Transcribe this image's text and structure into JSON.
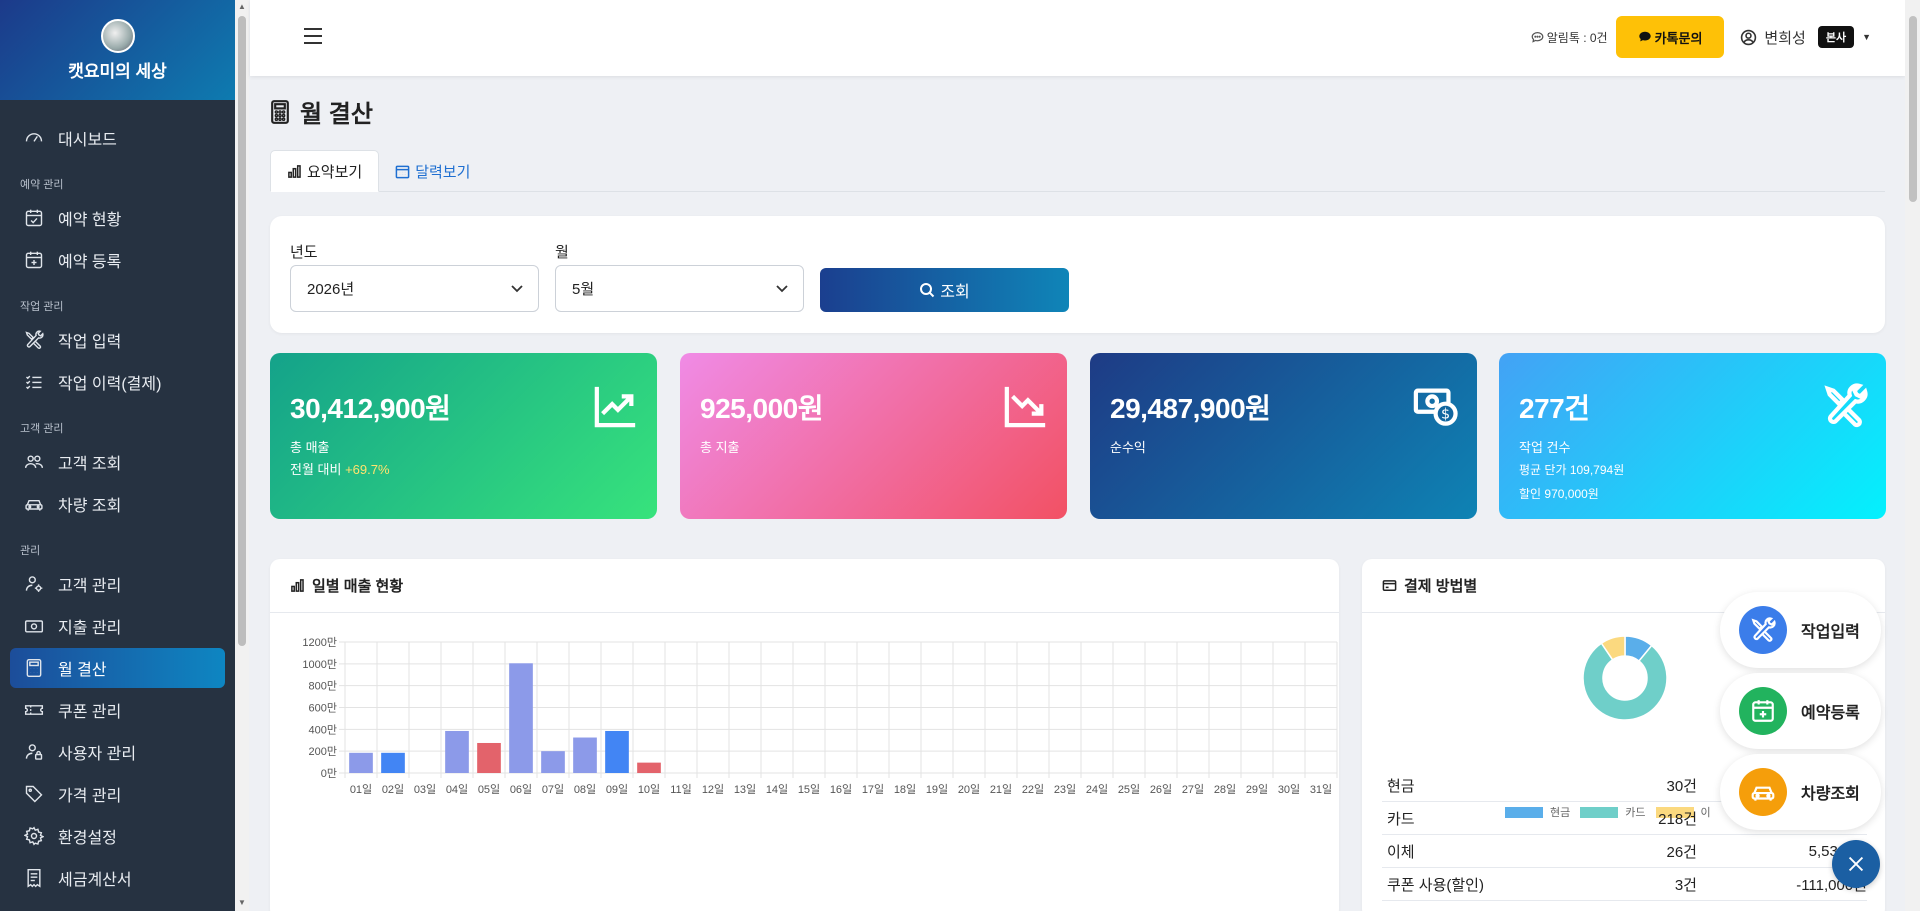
{
  "brand": {
    "name": "캣요미의 세상"
  },
  "sidebar": {
    "items": [
      {
        "type": "item",
        "label": "대시보드",
        "icon": "gauge-icon",
        "active": false
      },
      {
        "type": "section",
        "label": "예약 관리"
      },
      {
        "type": "item",
        "label": "예약 현황",
        "icon": "calendar-check-icon",
        "active": false
      },
      {
        "type": "item",
        "label": "예약 등록",
        "icon": "calendar-plus-icon",
        "active": false
      },
      {
        "type": "section",
        "label": "작업 관리"
      },
      {
        "type": "item",
        "label": "작업 입력",
        "icon": "tools-icon",
        "active": false
      },
      {
        "type": "item",
        "label": "작업 이력(결제)",
        "icon": "list-check-icon",
        "active": false
      },
      {
        "type": "section",
        "label": "고객 관리"
      },
      {
        "type": "item",
        "label": "고객 조회",
        "icon": "people-icon",
        "active": false
      },
      {
        "type": "item",
        "label": "차량 조회",
        "icon": "car-icon",
        "active": false
      },
      {
        "type": "section",
        "label": "관리"
      },
      {
        "type": "item",
        "label": "고객 관리",
        "icon": "person-gear-icon",
        "active": false
      },
      {
        "type": "item",
        "label": "지출 관리",
        "icon": "cash-icon",
        "active": false
      },
      {
        "type": "item",
        "label": "월 결산",
        "icon": "calculator-icon",
        "active": true
      },
      {
        "type": "item",
        "label": "쿠폰 관리",
        "icon": "ticket-icon",
        "active": false
      },
      {
        "type": "item",
        "label": "사용자 관리",
        "icon": "person-lock-icon",
        "active": false
      },
      {
        "type": "item",
        "label": "가격 관리",
        "icon": "tag-icon",
        "active": false
      },
      {
        "type": "item",
        "label": "환경설정",
        "icon": "gear-icon",
        "active": false
      },
      {
        "type": "item",
        "label": "세금계산서",
        "icon": "receipt-icon",
        "active": false
      }
    ]
  },
  "header": {
    "alarm_label": "알림톡 : 0건",
    "kakao_label": "카톡문의",
    "user_name": "변희성",
    "user_badge": "본사"
  },
  "page": {
    "title": "월 결산",
    "tabs": [
      {
        "label": "요약보기",
        "active": true
      },
      {
        "label": "달력보기",
        "active": false
      }
    ]
  },
  "filter": {
    "year_label": "년도",
    "year_value": "2026년",
    "month_label": "월",
    "month_value": "5월",
    "search_label": "조회"
  },
  "kpis": [
    {
      "value": "30,412,900원",
      "label": "총 매출",
      "extra_prefix": "전월 대비 ",
      "extra_highlight": "+69.7%",
      "icon": "trend-up-icon"
    },
    {
      "value": "925,000원",
      "label": "총 지출",
      "icon": "trend-down-icon"
    },
    {
      "value": "29,487,900원",
      "label": "순수익",
      "icon": "cash-coin-icon"
    },
    {
      "value": "277건",
      "label": "작업 건수",
      "extra1": "평균 단가 109,794원",
      "extra2": "할인 970,000원",
      "icon": "tools-icon"
    }
  ],
  "daily_chart": {
    "title": "일별 매출 현황"
  },
  "payment": {
    "title": "결제 방법별",
    "legend": [
      {
        "label": "현금",
        "color": "#5aaeea"
      },
      {
        "label": "카드",
        "color": "#6fcfc9"
      },
      {
        "label": "이",
        "color": "#fbd97f"
      }
    ],
    "rows": [
      {
        "method": "현금",
        "count": "30건",
        "amount": ""
      },
      {
        "method": "카드",
        "count": "218건",
        "amount": ""
      },
      {
        "method": "이체",
        "count": "26건",
        "amount": "5,530,00"
      },
      {
        "method": "쿠폰 사용(할인)",
        "count": "3건",
        "amount": "-111,000원"
      }
    ]
  },
  "chart_data": [
    {
      "type": "bar",
      "title": "일별 매출 현황",
      "categories": [
        "01일",
        "02일",
        "03일",
        "04일",
        "05일",
        "06일",
        "07일",
        "08일",
        "09일",
        "10일",
        "11일",
        "12일",
        "13일",
        "14일",
        "15일",
        "16일",
        "17일",
        "18일",
        "19일",
        "20일",
        "21일",
        "22일",
        "23일",
        "24일",
        "25일",
        "26일",
        "27일",
        "28일",
        "29일",
        "30일",
        "31일"
      ],
      "values": [
        185,
        185,
        0,
        385,
        275,
        1005,
        200,
        325,
        385,
        95,
        0,
        0,
        0,
        0,
        0,
        0,
        0,
        0,
        0,
        0,
        0,
        0,
        0,
        0,
        0,
        0,
        0,
        0,
        0,
        0,
        0
      ],
      "bar_colors": [
        "#8c9ae9",
        "#4285f4",
        "#8c9ae9",
        "#8c9ae9",
        "#e3636b",
        "#8c9ae9",
        "#8c9ae9",
        "#8c9ae9",
        "#4285f4",
        "#e3636b",
        "#8c9ae9",
        "#8c9ae9",
        "#8c9ae9",
        "#8c9ae9",
        "#8c9ae9",
        "#8c9ae9",
        "#8c9ae9",
        "#8c9ae9",
        "#8c9ae9",
        "#8c9ae9",
        "#8c9ae9",
        "#8c9ae9",
        "#8c9ae9",
        "#8c9ae9",
        "#8c9ae9",
        "#8c9ae9",
        "#8c9ae9",
        "#8c9ae9",
        "#8c9ae9",
        "#8c9ae9",
        "#8c9ae9"
      ],
      "y_ticks": [
        "0만",
        "200만",
        "400만",
        "600만",
        "800만",
        "1000만",
        "1200만"
      ],
      "ylim": [
        0,
        1200
      ],
      "grid": true
    },
    {
      "type": "pie",
      "title": "결제 방법별",
      "categories": [
        "현금",
        "카드",
        "이체"
      ],
      "values": [
        30,
        218,
        26
      ],
      "colors": [
        "#5aaeea",
        "#6fcfc9",
        "#fbd97f"
      ],
      "donut": true
    }
  ],
  "quick_actions": [
    {
      "label": "작업입력",
      "color": "#3b7dea",
      "icon": "tools-icon"
    },
    {
      "label": "예약등록",
      "color": "#22b35e",
      "icon": "calendar-plus-icon"
    },
    {
      "label": "차량조회",
      "color": "#f59e0b",
      "icon": "car-icon"
    }
  ]
}
